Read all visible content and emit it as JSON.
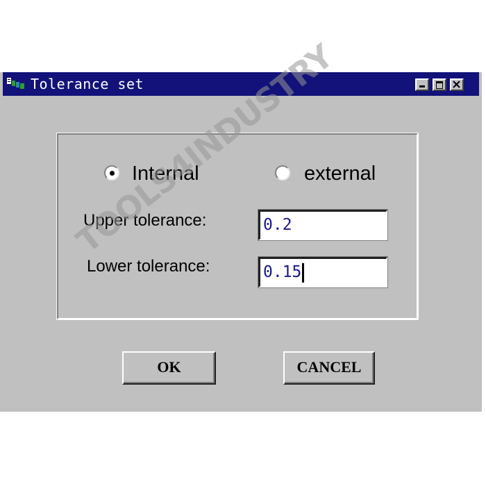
{
  "window": {
    "title": "Tolerance set",
    "icon": "app-icon"
  },
  "radio_group": {
    "options": [
      {
        "label": "Internal",
        "selected": true
      },
      {
        "label": "external",
        "selected": false
      }
    ]
  },
  "fields": {
    "upper": {
      "label": "Upper tolerance:",
      "value": "0.2"
    },
    "lower": {
      "label": "Lower tolerance:",
      "value": "0.15"
    }
  },
  "buttons": {
    "ok_label": "OK",
    "cancel_label": "CANCEL"
  },
  "watermark": "TOOLS4INDUSTRY",
  "colors": {
    "titlebar": "#12127a",
    "window_bg": "#c0c0c0",
    "input_text": "#1a1a8a"
  }
}
